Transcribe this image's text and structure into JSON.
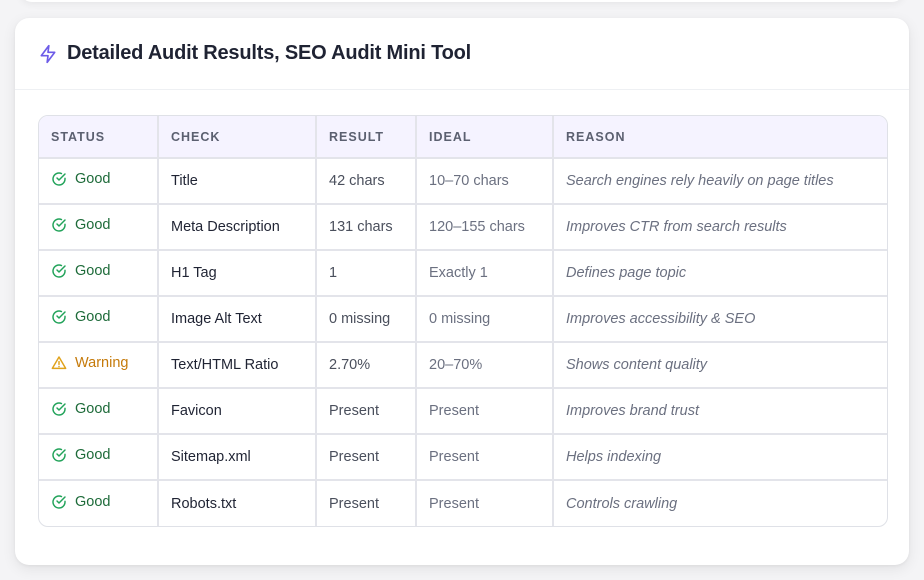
{
  "panel": {
    "title": "Detailed Audit Results, SEO Audit Mini Tool",
    "icon": "lightning-icon",
    "accent_color": "#6d5ce8"
  },
  "table": {
    "columns": [
      "STATUS",
      "CHECK",
      "RESULT",
      "IDEAL",
      "REASON"
    ],
    "rows": [
      {
        "status": "Good",
        "status_type": "good",
        "check": "Title",
        "result": "42 chars",
        "ideal": "10–70 chars",
        "reason": "Search engines rely heavily on page titles"
      },
      {
        "status": "Good",
        "status_type": "good",
        "check": "Meta Description",
        "result": "131 chars",
        "ideal": "120–155 chars",
        "reason": "Improves CTR from search results"
      },
      {
        "status": "Good",
        "status_type": "good",
        "check": "H1 Tag",
        "result": "1",
        "ideal": "Exactly 1",
        "reason": "Defines page topic"
      },
      {
        "status": "Good",
        "status_type": "good",
        "check": "Image Alt Text",
        "result": "0 missing",
        "ideal": "0 missing",
        "reason": "Improves accessibility & SEO"
      },
      {
        "status": "Warning",
        "status_type": "warn",
        "check": "Text/HTML Ratio",
        "result": "2.70%",
        "ideal": "20–70%",
        "reason": "Shows content quality"
      },
      {
        "status": "Good",
        "status_type": "good",
        "check": "Favicon",
        "result": "Present",
        "ideal": "Present",
        "reason": "Improves brand trust"
      },
      {
        "status": "Good",
        "status_type": "good",
        "check": "Sitemap.xml",
        "result": "Present",
        "ideal": "Present",
        "reason": "Helps indexing"
      },
      {
        "status": "Good",
        "status_type": "good",
        "check": "Robots.txt",
        "result": "Present",
        "ideal": "Present",
        "reason": "Controls crawling"
      }
    ]
  },
  "colors": {
    "good": "#22a35a",
    "warning": "#e0a21b"
  }
}
